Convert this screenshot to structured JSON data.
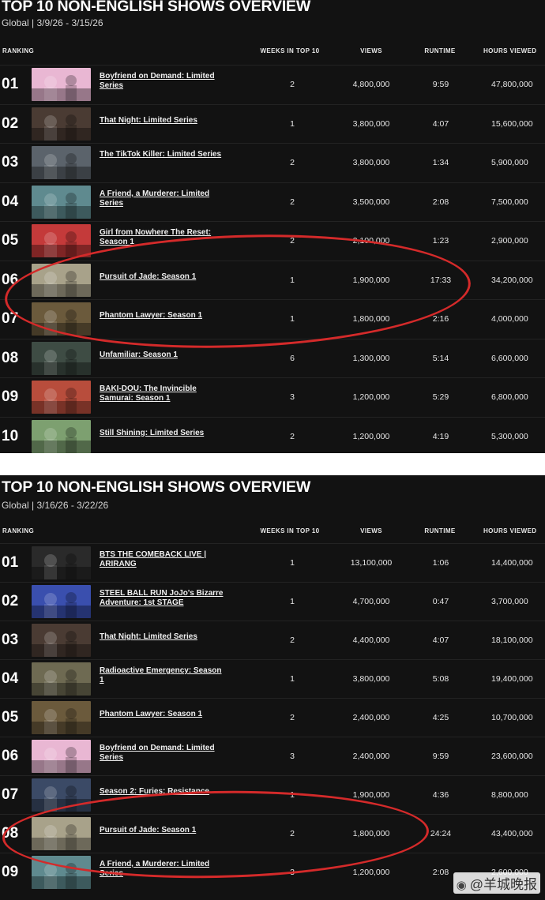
{
  "panels": [
    {
      "title": "TOP 10 NON-ENGLISH SHOWS OVERVIEW",
      "subtitle": "Global | 3/9/26 - 3/15/26",
      "headers": {
        "rank": "RANKING",
        "weeks": "WEEKS IN TOP 10",
        "views": "VIEWS",
        "runtime": "RUNTIME",
        "hours": "HOURS VIEWED"
      },
      "rows": [
        {
          "rank": "01",
          "title": "Boyfriend on Demand: Limited Series",
          "weeks": "2",
          "views": "4,800,000",
          "runtime": "9:59",
          "hours": "47,800,000",
          "thumb_color": "#e9b7d3"
        },
        {
          "rank": "02",
          "title": "That Night: Limited Series",
          "weeks": "1",
          "views": "3,800,000",
          "runtime": "4:07",
          "hours": "15,600,000",
          "thumb_color": "#4a3b33"
        },
        {
          "rank": "03",
          "title": "The TikTok Killer: Limited Series",
          "weeks": "2",
          "views": "3,800,000",
          "runtime": "1:34",
          "hours": "5,900,000",
          "thumb_color": "#5b636b"
        },
        {
          "rank": "04",
          "title": "A Friend, a Murderer: Limited Series",
          "weeks": "2",
          "views": "3,500,000",
          "runtime": "2:08",
          "hours": "7,500,000",
          "thumb_color": "#5f8a8f"
        },
        {
          "rank": "05",
          "title": "Girl from Nowhere The Reset: Season 1",
          "weeks": "2",
          "views": "2,100,000",
          "runtime": "1:23",
          "hours": "2,900,000",
          "thumb_color": "#c43a3a"
        },
        {
          "rank": "06",
          "title": "Pursuit of Jade: Season 1",
          "weeks": "1",
          "views": "1,900,000",
          "runtime": "17:33",
          "hours": "34,200,000",
          "thumb_color": "#a8a28a"
        },
        {
          "rank": "07",
          "title": "Phantom Lawyer: Season 1",
          "weeks": "1",
          "views": "1,800,000",
          "runtime": "2:16",
          "hours": "4,000,000",
          "thumb_color": "#6b5a3c"
        },
        {
          "rank": "08",
          "title": "Unfamiliar: Season 1",
          "weeks": "6",
          "views": "1,300,000",
          "runtime": "5:14",
          "hours": "6,600,000",
          "thumb_color": "#3e4c44"
        },
        {
          "rank": "09",
          "title": "BAKI-DOU: The Invincible Samurai: Season 1",
          "weeks": "3",
          "views": "1,200,000",
          "runtime": "5:29",
          "hours": "6,800,000",
          "thumb_color": "#b84d3c"
        },
        {
          "rank": "10",
          "title": "Still Shining: Limited Series",
          "weeks": "2",
          "views": "1,200,000",
          "runtime": "4:19",
          "hours": "5,300,000",
          "thumb_color": "#7da070"
        }
      ]
    },
    {
      "title": "TOP 10 NON-ENGLISH SHOWS OVERVIEW",
      "subtitle": "Global | 3/16/26 - 3/22/26",
      "headers": {
        "rank": "RANKING",
        "weeks": "WEEKS IN TOP 10",
        "views": "VIEWS",
        "runtime": "RUNTIME",
        "hours": "HOURS VIEWED"
      },
      "rows": [
        {
          "rank": "01",
          "title": "BTS THE COMEBACK LIVE | ARIRANG",
          "weeks": "1",
          "views": "13,100,000",
          "runtime": "1:06",
          "hours": "14,400,000",
          "thumb_color": "#2a2a2a"
        },
        {
          "rank": "02",
          "title": "STEEL BALL RUN JoJo's Bizarre Adventure: 1st STAGE",
          "weeks": "1",
          "views": "4,700,000",
          "runtime": "0:47",
          "hours": "3,700,000",
          "thumb_color": "#3a4fae"
        },
        {
          "rank": "03",
          "title": "That Night: Limited Series",
          "weeks": "2",
          "views": "4,400,000",
          "runtime": "4:07",
          "hours": "18,100,000",
          "thumb_color": "#4a3b33"
        },
        {
          "rank": "04",
          "title": "Radioactive Emergency: Season 1",
          "weeks": "1",
          "views": "3,800,000",
          "runtime": "5:08",
          "hours": "19,400,000",
          "thumb_color": "#6e6a52"
        },
        {
          "rank": "05",
          "title": "Phantom Lawyer: Season 1",
          "weeks": "2",
          "views": "2,400,000",
          "runtime": "4:25",
          "hours": "10,700,000",
          "thumb_color": "#6b5a3c"
        },
        {
          "rank": "06",
          "title": "Boyfriend on Demand: Limited Series",
          "weeks": "3",
          "views": "2,400,000",
          "runtime": "9:59",
          "hours": "23,600,000",
          "thumb_color": "#e9b7d3"
        },
        {
          "rank": "07",
          "title": "Season 2: Furies: Resistance",
          "weeks": "1",
          "views": "1,900,000",
          "runtime": "4:36",
          "hours": "8,800,000",
          "thumb_color": "#3b4a66"
        },
        {
          "rank": "08",
          "title": "Pursuit of Jade: Season 1",
          "weeks": "2",
          "views": "1,800,000",
          "runtime": "24:24",
          "hours": "43,400,000",
          "thumb_color": "#a8a28a"
        },
        {
          "rank": "09",
          "title": "A Friend, a Murderer: Limited Series",
          "weeks": "3",
          "views": "1,200,000",
          "runtime": "2:08",
          "hours": "2,600,000",
          "thumb_color": "#5f8a8f"
        }
      ]
    }
  ],
  "watermark": {
    "brand_icon": "weibo-icon",
    "text": "@羊城晚报"
  },
  "colors": {
    "background": "#121212",
    "text": "#f2f2f2",
    "circle": "#d42a2a"
  }
}
